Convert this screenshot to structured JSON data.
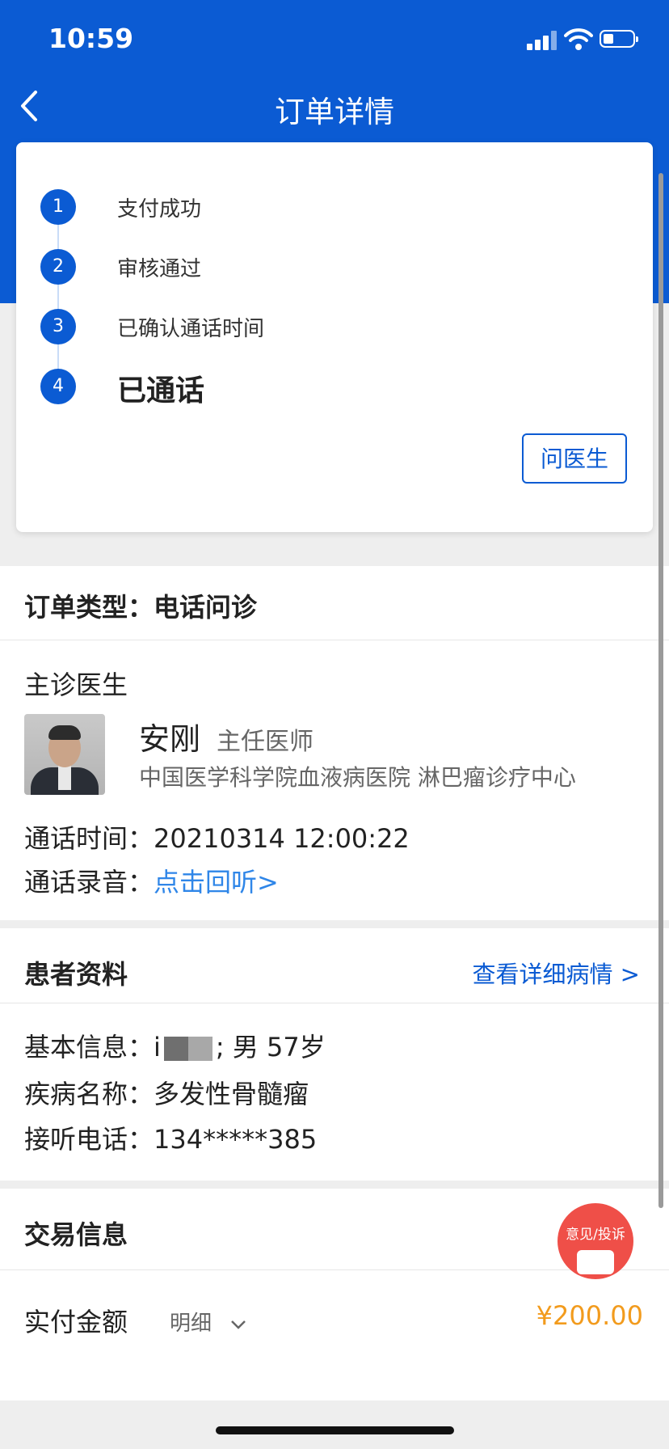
{
  "status_bar": {
    "time": "10:59"
  },
  "nav": {
    "title": "订单详情"
  },
  "progress": {
    "steps": [
      {
        "num": "1",
        "label": "支付成功"
      },
      {
        "num": "2",
        "label": "审核通过"
      },
      {
        "num": "3",
        "label": "已确认通话时间"
      },
      {
        "num": "4",
        "label": "已通话"
      }
    ],
    "ask_button": "问医生"
  },
  "order": {
    "type_label": "订单类型：",
    "type_value": "电话问诊"
  },
  "doctor": {
    "section_label": "主诊医生",
    "name": "安刚",
    "title": "主任医师",
    "hospital": "中国医学科学院血液病医院 淋巴瘤诊疗中心",
    "call_time_label": "通话时间：",
    "call_time_value": "20210314 12:00:22",
    "recording_label": "通话录音：",
    "recording_link": "点击回听>"
  },
  "patient": {
    "section_label": "患者资料",
    "detail_link": "查看详细病情 >",
    "basic_label": "基本信息：",
    "basic_prefix": "i",
    "basic_suffix": "; 男 57岁",
    "disease_label": "疾病名称：",
    "disease_value": "多发性骨髓瘤",
    "phone_label": "接听电话：",
    "phone_value": "134*****385"
  },
  "trade": {
    "section_label": "交易信息",
    "paid_label": "实付金额",
    "detail_label": "明细",
    "amount": "¥200.00"
  },
  "feedback": {
    "label": "意见/投诉"
  },
  "colors": {
    "brand_blue": "#0b5bd3",
    "link_blue": "#2f86e8",
    "price_orange": "#f29b1d",
    "feedback_red": "#ef4f48"
  }
}
